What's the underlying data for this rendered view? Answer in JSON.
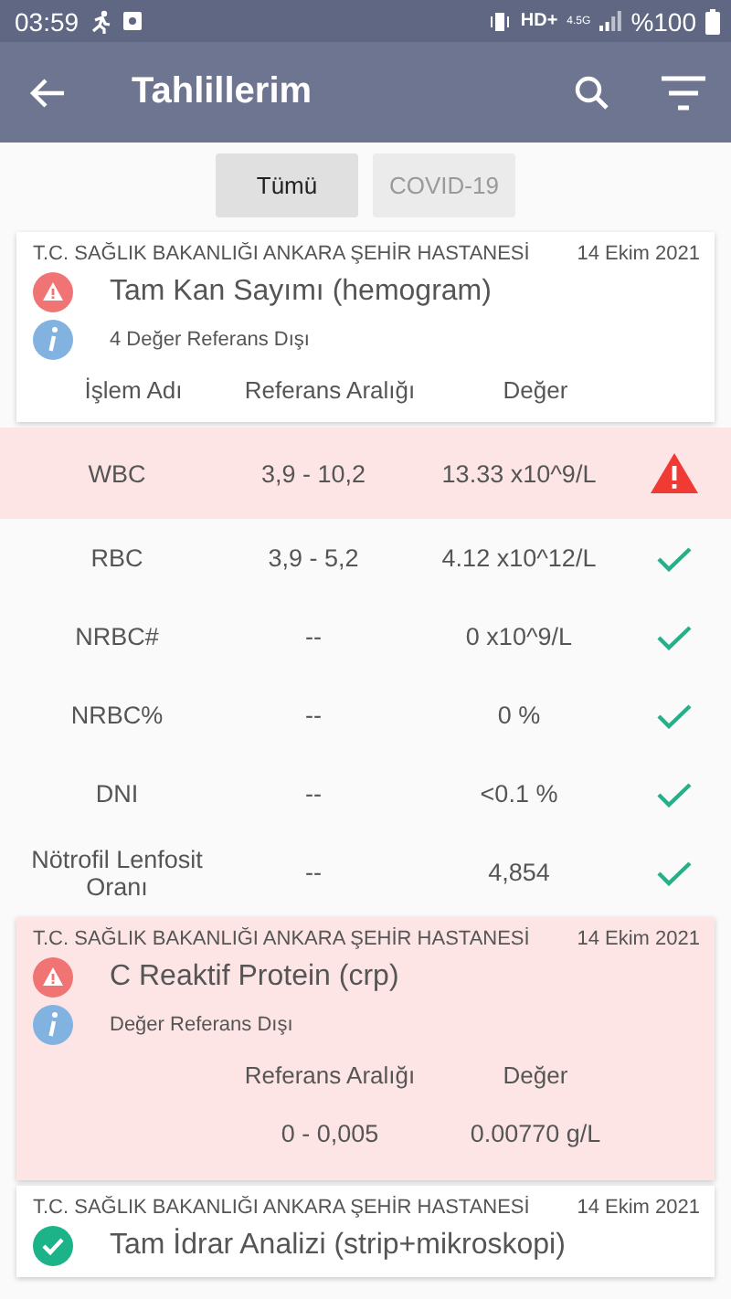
{
  "status_bar": {
    "time": "03:59",
    "network": "HD+",
    "signal_label": "4.5G",
    "battery": "%100"
  },
  "app_bar": {
    "title": "Tahlillerim"
  },
  "filters": [
    {
      "label": "Tümü",
      "selected": true
    },
    {
      "label": "COVID-19",
      "selected": false
    }
  ],
  "results": [
    {
      "kind": "table",
      "flagged": true,
      "hospital": "T.C. SAĞLIK BAKANLIĞI ANKARA ŞEHİR HASTANESİ",
      "date": "14 Ekim 2021",
      "title": "Tam Kan Sayımı (hemogram)",
      "note": "4 Değer Referans Dışı",
      "columns": [
        "İşlem Adı",
        "Referans Aralığı",
        "Değer"
      ],
      "rows": [
        {
          "name": "WBC",
          "range": "3,9 - 10,2",
          "value": "13.33 x10^9/L",
          "flagged": true
        },
        {
          "name": "RBC",
          "range": "3,9 - 5,2",
          "value": "4.12 x10^12/L",
          "flagged": false
        },
        {
          "name": "NRBC#",
          "range": "--",
          "value": "0 x10^9/L",
          "flagged": false
        },
        {
          "name": "NRBC%",
          "range": "--",
          "value": "0 %",
          "flagged": false
        },
        {
          "name": "DNI",
          "range": "--",
          "value": "<0.1 %",
          "flagged": false
        },
        {
          "name": "Nötrofil Lenfosit Oranı",
          "range": "--",
          "value": "4,854",
          "flagged": false
        }
      ]
    },
    {
      "kind": "inline",
      "flagged": true,
      "hospital": "T.C. SAĞLIK BAKANLIĞI ANKARA ŞEHİR HASTANESİ",
      "date": "14 Ekim 2021",
      "title": "C Reaktif Protein (crp)",
      "note": "Değer Referans Dışı",
      "columns": [
        "Referans Aralığı",
        "Değer"
      ],
      "rows": [
        {
          "range": "0 - 0,005",
          "value": "0.00770 g/L"
        }
      ]
    },
    {
      "kind": "inline",
      "flagged": false,
      "hospital": "T.C. SAĞLIK BAKANLIĞI ANKARA ŞEHİR HASTANESİ",
      "date": "14 Ekim 2021",
      "title": "Tam İdrar Analizi (strip+mikroskopi)"
    }
  ]
}
